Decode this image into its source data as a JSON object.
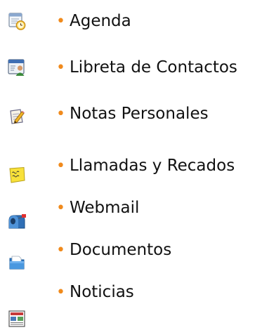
{
  "menu": {
    "items": [
      {
        "label": "Agenda",
        "icon": "calendar-clock-icon"
      },
      {
        "label": "Libreta de Contactos",
        "icon": "contact-card-icon"
      },
      {
        "label": "Notas Personales",
        "icon": "note-pencil-icon"
      },
      {
        "label": "Llamadas y Recados",
        "icon": "sticky-note-icon"
      },
      {
        "label": "Webmail",
        "icon": "mailbox-icon"
      },
      {
        "label": "Documentos",
        "icon": "folder-icon"
      },
      {
        "label": "Noticias",
        "icon": "newspaper-icon"
      }
    ],
    "bullet": "•"
  },
  "colors": {
    "bullet": "#f08a1c",
    "text": "#111111"
  }
}
